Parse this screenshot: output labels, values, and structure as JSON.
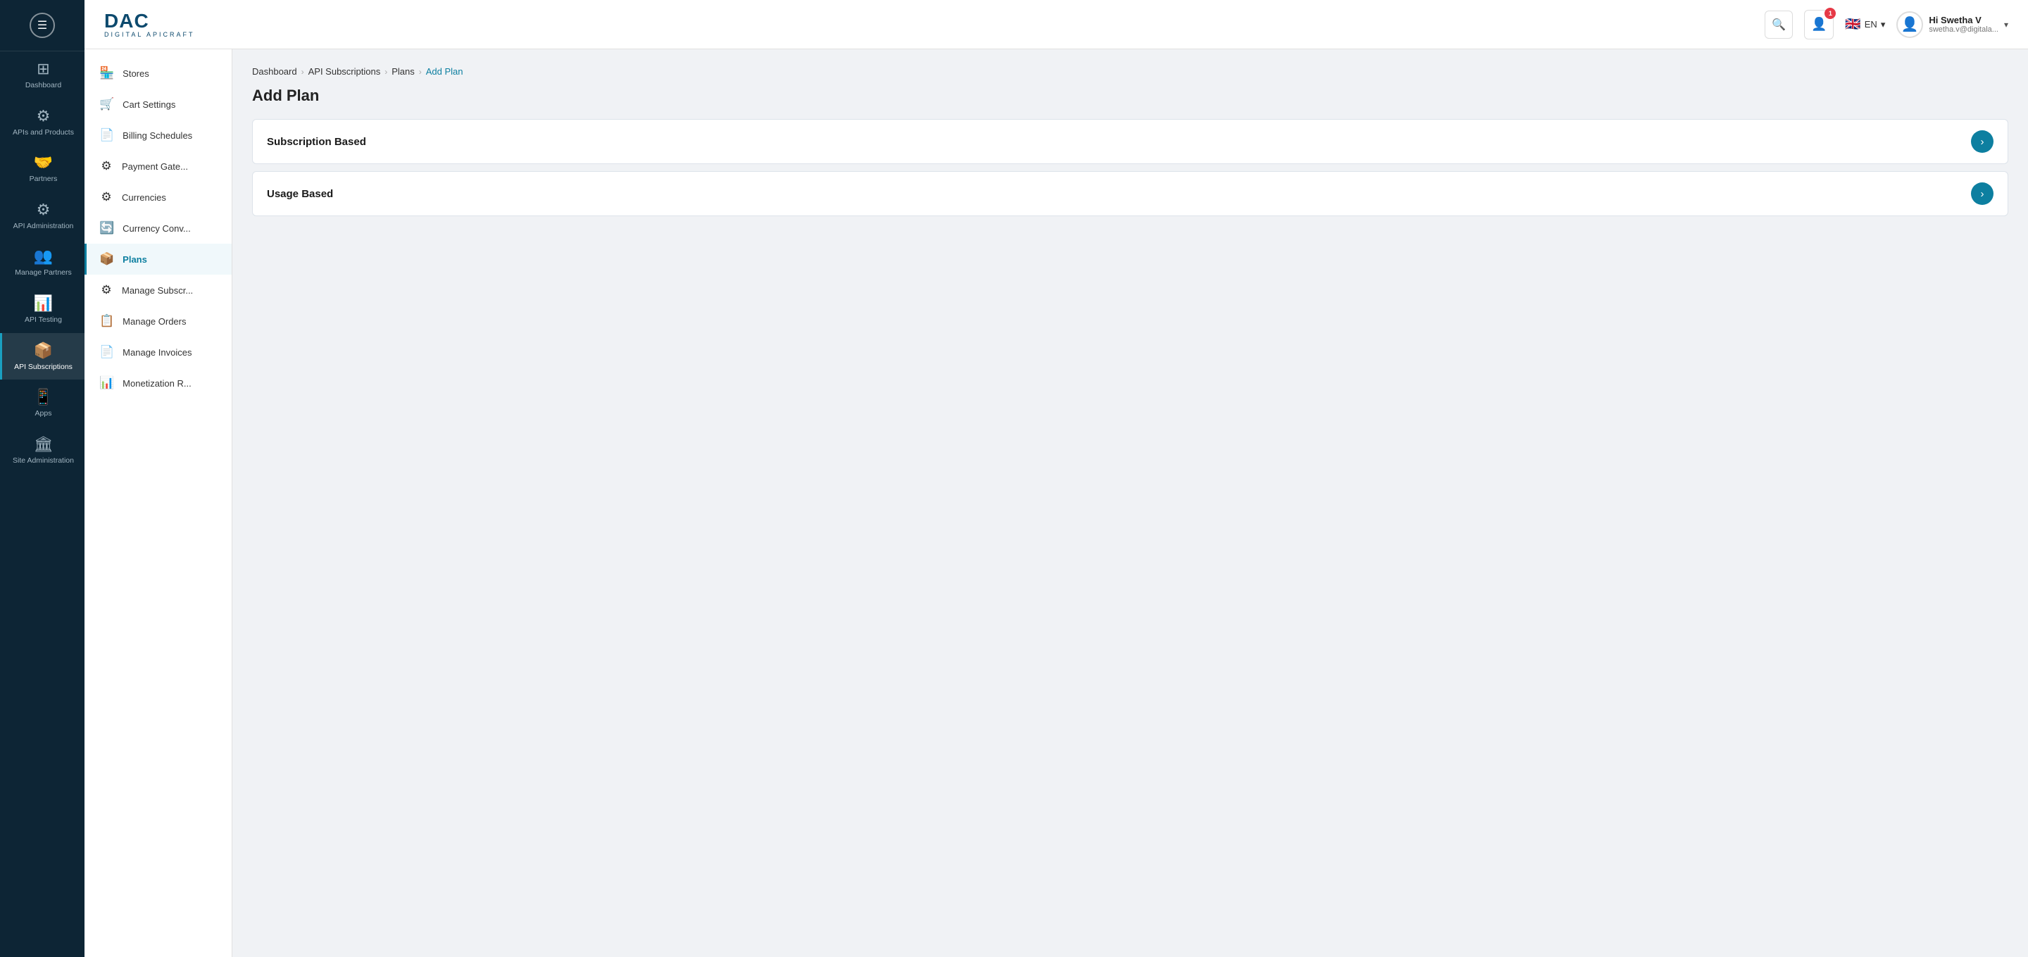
{
  "sidebar_dark": {
    "items": [
      {
        "id": "dashboard",
        "label": "Dashboard",
        "icon": "⊞",
        "active": false
      },
      {
        "id": "apis-and-products",
        "label": "APIs and Products",
        "icon": "⚙",
        "active": false
      },
      {
        "id": "partners",
        "label": "Partners",
        "icon": "🤝",
        "active": false
      },
      {
        "id": "api-administration",
        "label": "API Administration",
        "icon": "⚙",
        "active": false
      },
      {
        "id": "manage-partners",
        "label": "Manage Partners",
        "icon": "👥",
        "active": false
      },
      {
        "id": "api-testing",
        "label": "API Testing",
        "icon": "📊",
        "active": false
      },
      {
        "id": "api-subscriptions",
        "label": "API Subscriptions",
        "icon": "📦",
        "active": true
      },
      {
        "id": "apps",
        "label": "Apps",
        "icon": "📱",
        "active": false
      },
      {
        "id": "site-administration",
        "label": "Site Administration",
        "icon": "🏛",
        "active": false
      }
    ]
  },
  "sidebar_secondary": {
    "items": [
      {
        "id": "stores",
        "label": "Stores",
        "icon": "🏪",
        "active": false
      },
      {
        "id": "cart-settings",
        "label": "Cart Settings",
        "icon": "🛒",
        "active": false
      },
      {
        "id": "billing-schedules",
        "label": "Billing Schedules",
        "icon": "📄",
        "active": false
      },
      {
        "id": "payment-gateway",
        "label": "Payment Gate...",
        "icon": "⚙",
        "active": false
      },
      {
        "id": "currencies",
        "label": "Currencies",
        "icon": "⚙",
        "active": false
      },
      {
        "id": "currency-conv",
        "label": "Currency Conv...",
        "icon": "🔄",
        "active": false
      },
      {
        "id": "plans",
        "label": "Plans",
        "icon": "📦",
        "active": true
      },
      {
        "id": "manage-subscriptions",
        "label": "Manage Subscr...",
        "icon": "⚙",
        "active": false
      },
      {
        "id": "manage-orders",
        "label": "Manage Orders",
        "icon": "📋",
        "active": false
      },
      {
        "id": "manage-invoices",
        "label": "Manage Invoices",
        "icon": "📄",
        "active": false
      },
      {
        "id": "monetization-r",
        "label": "Monetization R...",
        "icon": "📊",
        "active": false
      }
    ]
  },
  "header": {
    "logo_text": "DAC",
    "logo_sub": "DIGITAL APICRAFT",
    "search_placeholder": "Search",
    "notification_count": "1",
    "language": "EN",
    "user_name": "Hi Swetha V",
    "user_email": "swetha.v@digitala..."
  },
  "breadcrumb": {
    "items": [
      {
        "label": "Dashboard",
        "active": false
      },
      {
        "label": "API Subscriptions",
        "active": false
      },
      {
        "label": "Plans",
        "active": false
      },
      {
        "label": "Add Plan",
        "active": true
      }
    ]
  },
  "page": {
    "title": "Add Plan",
    "plan_options": [
      {
        "id": "subscription-based",
        "label": "Subscription Based"
      },
      {
        "id": "usage-based",
        "label": "Usage Based"
      }
    ]
  }
}
